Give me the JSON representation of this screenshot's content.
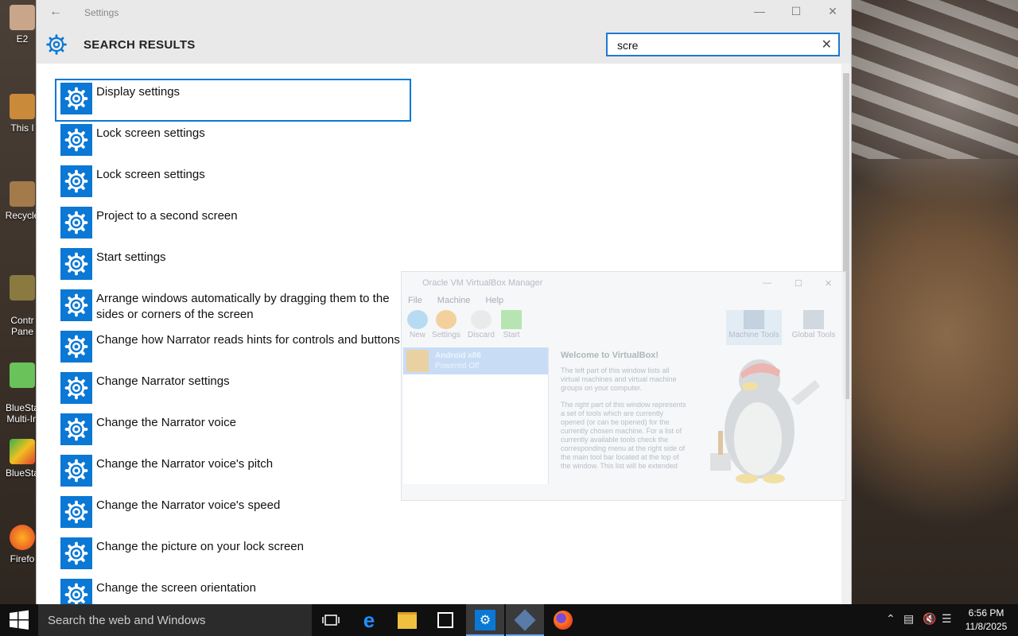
{
  "desktop": {
    "icons": [
      {
        "label": "E2"
      },
      {
        "label": "This I"
      },
      {
        "label": "Recycle"
      },
      {
        "label": "Contr\nPane"
      },
      {
        "label": "BlueSta\nMulti-In"
      },
      {
        "label": "BlueSta"
      },
      {
        "label": "Firefo"
      }
    ]
  },
  "settings": {
    "window_title": "Settings",
    "header_label": "SEARCH RESULTS",
    "search_value": "scre",
    "results": [
      {
        "label": "Display settings",
        "selected": true
      },
      {
        "label": "Lock screen settings"
      },
      {
        "label": "Lock screen settings"
      },
      {
        "label": "Project to a second screen"
      },
      {
        "label": "Start settings"
      },
      {
        "label": "Arrange windows automatically by dragging them to the sides or corners of the screen"
      },
      {
        "label": "Change how Narrator reads hints for controls and buttons"
      },
      {
        "label": "Change Narrator settings"
      },
      {
        "label": "Change the Narrator voice"
      },
      {
        "label": "Change the Narrator voice's pitch"
      },
      {
        "label": "Change the Narrator voice's speed"
      },
      {
        "label": "Change the picture on your lock screen"
      },
      {
        "label": "Change the screen orientation"
      }
    ]
  },
  "virtualbox": {
    "title": "Oracle VM VirtualBox Manager",
    "menu": [
      "File",
      "Machine",
      "Help"
    ],
    "toolbar": [
      "New",
      "Settings",
      "Discard",
      "Start",
      "Machine Tools",
      "Global Tools"
    ],
    "vm": {
      "name": "Android x86",
      "state": "Powered Off"
    },
    "welcome_title": "Welcome to VirtualBox!",
    "welcome_p1": "The left part of this window lists all virtual machines and virtual machine groups on your computer.",
    "welcome_p2": "The right part of this window represents a set of tools which are currently opened (or can be opened) for the currently chosen machine. For a list of currently available tools check the corresponding menu at the right side of the main tool bar located at the top of the window. This list will be extended with new"
  },
  "taskbar": {
    "search_placeholder": "Search the web and Windows",
    "time": "6:56 PM",
    "date": "11/8/2025"
  }
}
